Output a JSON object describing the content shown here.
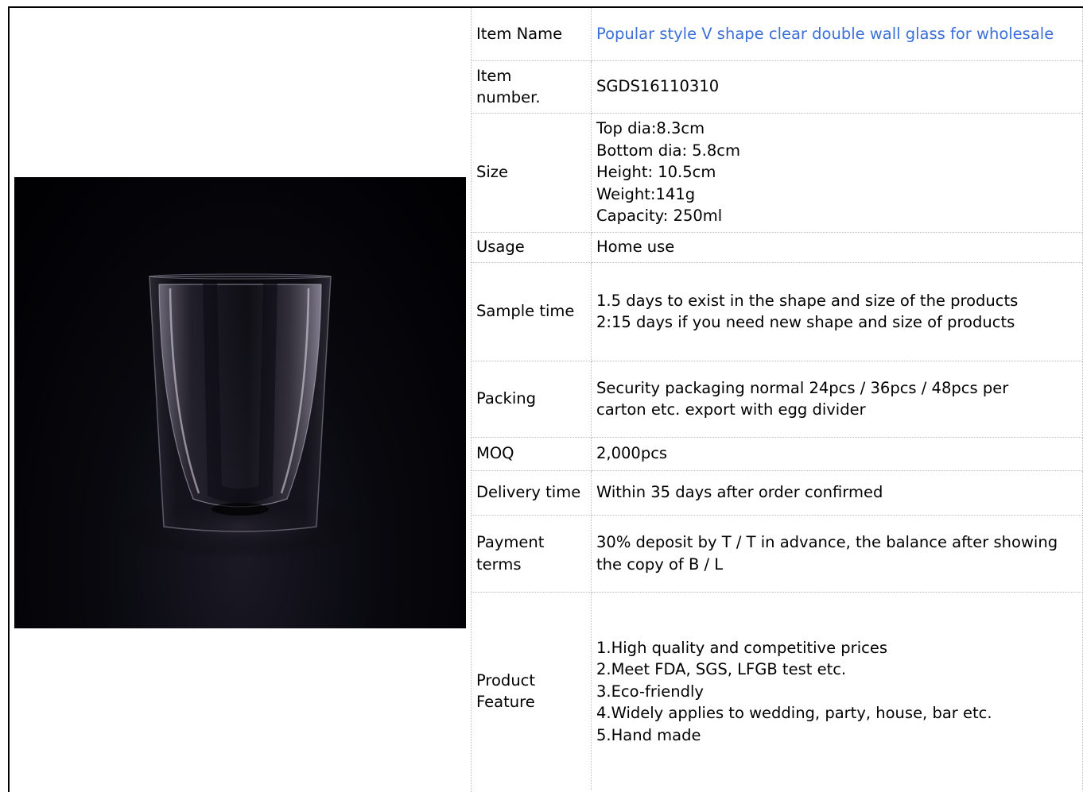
{
  "product": {
    "image_alt": "double wall glass cup",
    "rows": [
      {
        "label": "Item Name",
        "lines": [
          "Popular style V shape clear  double wall glass for wholesale"
        ]
      },
      {
        "label": "Item number.",
        "lines": [
          "SGDS16110310"
        ]
      },
      {
        "label": "Size",
        "lines": [
          "Top dia:8.3cm",
          "Bottom dia: 5.8cm",
          "Height: 10.5cm",
          "Weight:141g",
          "Capacity: 250ml"
        ]
      },
      {
        "label": "Usage",
        "lines": [
          "Home use"
        ]
      },
      {
        "label": "Sample time",
        "lines": [
          "1.5 days to exist in the shape and size of the products",
          "2:15 days if you need new shape and size of products"
        ]
      },
      {
        "label": "Packing",
        "lines": [
          "Security packaging normal 24pcs / 36pcs / 48pcs per",
          "carton etc. export with egg divider"
        ]
      },
      {
        "label": "MOQ",
        "lines": [
          "2,000pcs"
        ]
      },
      {
        "label": "Delivery time",
        "lines": [
          "Within 35 days after order confirmed"
        ]
      },
      {
        "label": "Payment terms",
        "lines": [
          "30% deposit by T / T in advance, the balance after showing",
          "the copy of B / L"
        ]
      },
      {
        "label": "Product Feature",
        "lines": [
          "1.High quality and competitive prices",
          "2.Meet FDA, SGS, LFGB test etc.",
          "3.Eco-friendly",
          "4.Widely applies to wedding, party, house, bar etc.",
          "5.Hand made"
        ]
      }
    ]
  }
}
